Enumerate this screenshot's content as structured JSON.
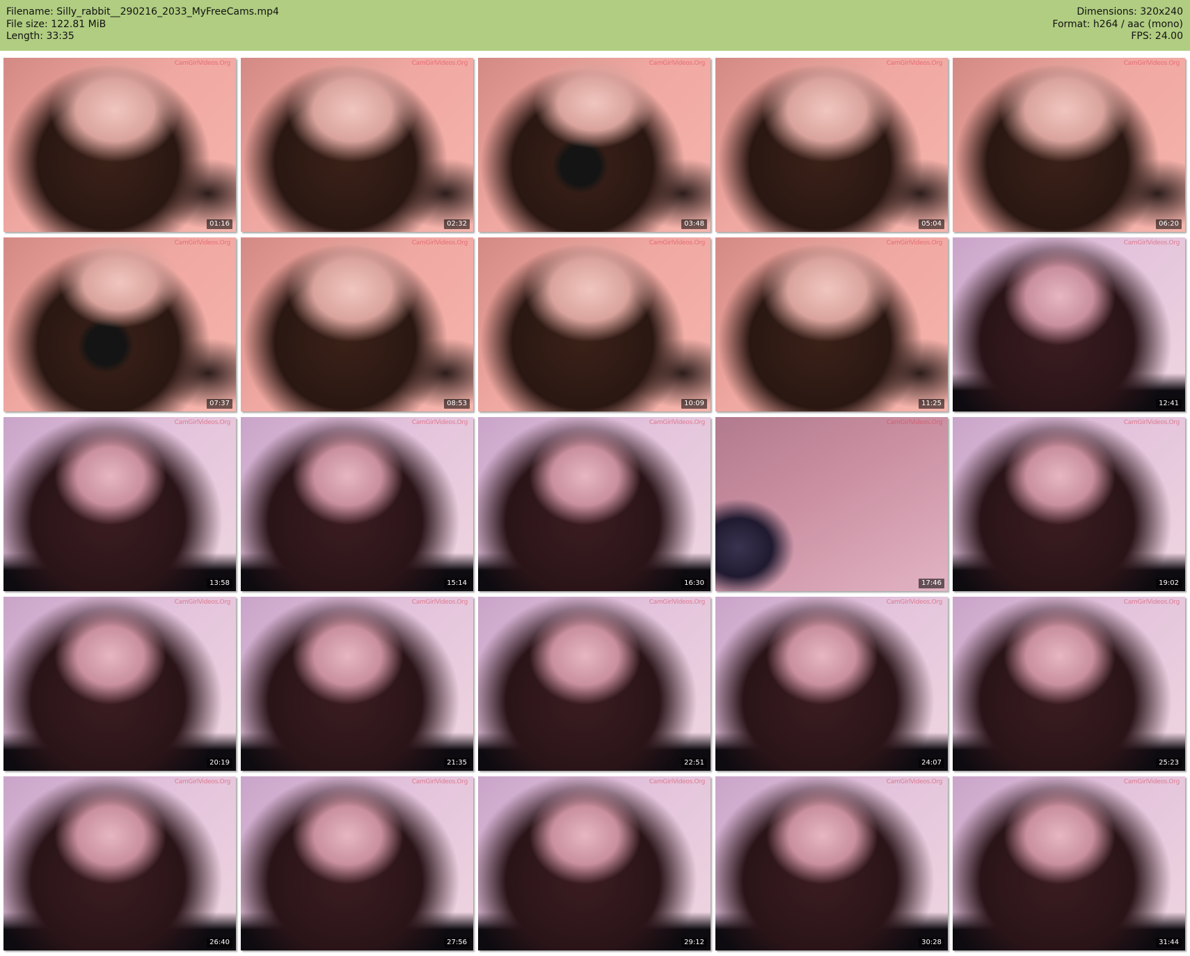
{
  "header": {
    "filename": "Filename: Silly_rabbit__290216_2033_MyFreeCams.mp4",
    "filesize": "File size: 122.81 MiB",
    "length": "Length: 33:35",
    "dimensions": "Dimensions: 320x240",
    "format": "Format: h264 / aac (mono)",
    "fps": "FPS: 24.00"
  },
  "watermark": "CamGirlVideos.Org",
  "colors": {
    "header_bg": "#b1cd82",
    "page_bg": "#ffffff"
  },
  "thumbnails": [
    {
      "time": "01:16",
      "scene": "warm"
    },
    {
      "time": "02:32",
      "scene": "warm"
    },
    {
      "time": "03:48",
      "scene": "warm-phone"
    },
    {
      "time": "05:04",
      "scene": "warm"
    },
    {
      "time": "06:20",
      "scene": "warm"
    },
    {
      "time": "07:37",
      "scene": "warm-phone"
    },
    {
      "time": "08:53",
      "scene": "warm"
    },
    {
      "time": "10:09",
      "scene": "warm"
    },
    {
      "time": "11:25",
      "scene": "warm"
    },
    {
      "time": "12:41",
      "scene": "cool"
    },
    {
      "time": "13:58",
      "scene": "cool"
    },
    {
      "time": "15:14",
      "scene": "cool"
    },
    {
      "time": "16:30",
      "scene": "cool"
    },
    {
      "time": "17:46",
      "scene": "dark-wall"
    },
    {
      "time": "19:02",
      "scene": "cool"
    },
    {
      "time": "20:19",
      "scene": "cool"
    },
    {
      "time": "21:35",
      "scene": "cool"
    },
    {
      "time": "22:51",
      "scene": "cool"
    },
    {
      "time": "24:07",
      "scene": "cool"
    },
    {
      "time": "25:23",
      "scene": "cool"
    },
    {
      "time": "26:40",
      "scene": "cool"
    },
    {
      "time": "27:56",
      "scene": "cool"
    },
    {
      "time": "29:12",
      "scene": "cool"
    },
    {
      "time": "30:28",
      "scene": "cool"
    },
    {
      "time": "31:44",
      "scene": "cool"
    }
  ]
}
